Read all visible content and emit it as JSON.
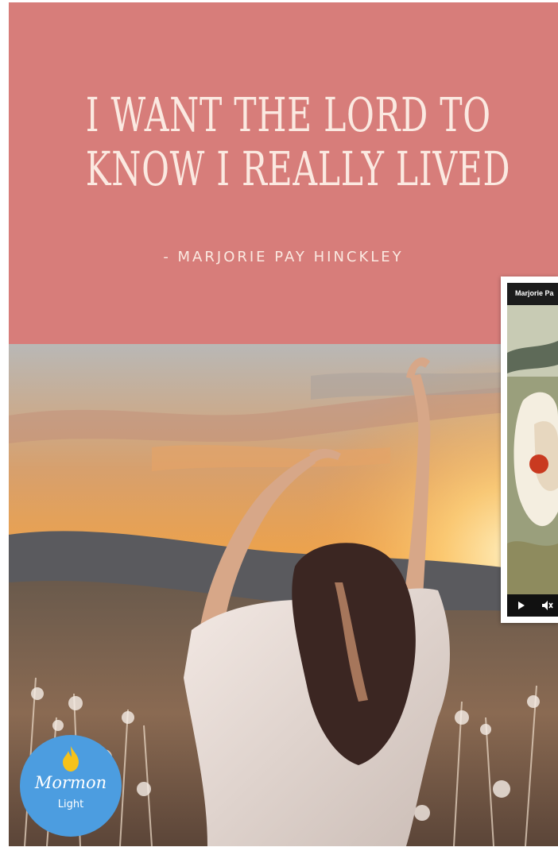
{
  "quote": {
    "line1": "I WANT THE LORD TO",
    "line2": "KNOW I REALLY LIVED",
    "attribution": "- MARJORIE PAY HINCKLEY"
  },
  "logo": {
    "name": "Mormon",
    "sub": "Light",
    "icon": "flame-icon"
  },
  "video": {
    "title": "Marjorie Pa",
    "controls": {
      "play_icon": "play-icon",
      "mute_icon": "muted-speaker-icon"
    }
  },
  "colors": {
    "banner": "#d77d7a",
    "quote_text": "#fbe9e1",
    "logo_badge": "#4c9de0",
    "logo_flame": "#f6c21a"
  }
}
